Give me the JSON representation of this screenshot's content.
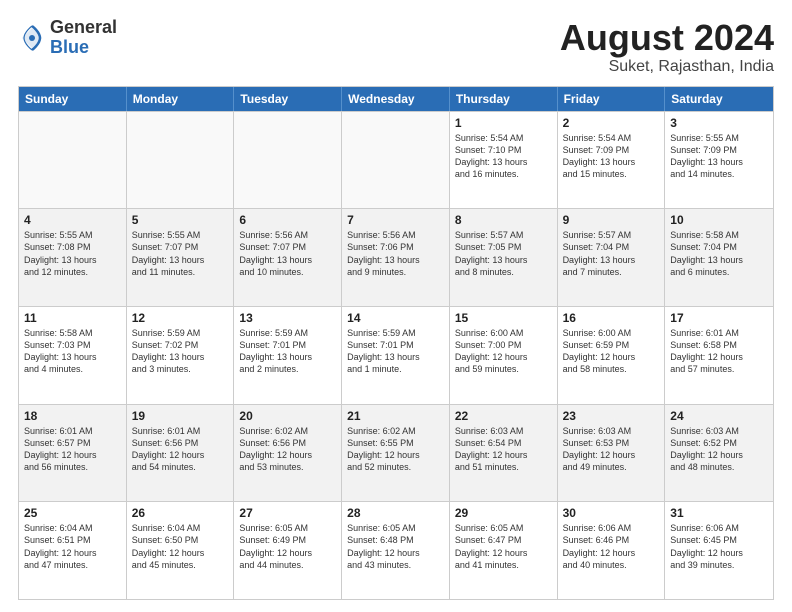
{
  "logo": {
    "general": "General",
    "blue": "Blue"
  },
  "title": "August 2024",
  "location": "Suket, Rajasthan, India",
  "days": [
    "Sunday",
    "Monday",
    "Tuesday",
    "Wednesday",
    "Thursday",
    "Friday",
    "Saturday"
  ],
  "rows": [
    [
      {
        "day": "",
        "text": "",
        "empty": true
      },
      {
        "day": "",
        "text": "",
        "empty": true
      },
      {
        "day": "",
        "text": "",
        "empty": true
      },
      {
        "day": "",
        "text": "",
        "empty": true
      },
      {
        "day": "1",
        "text": "Sunrise: 5:54 AM\nSunset: 7:10 PM\nDaylight: 13 hours\nand 16 minutes.",
        "empty": false
      },
      {
        "day": "2",
        "text": "Sunrise: 5:54 AM\nSunset: 7:09 PM\nDaylight: 13 hours\nand 15 minutes.",
        "empty": false
      },
      {
        "day": "3",
        "text": "Sunrise: 5:55 AM\nSunset: 7:09 PM\nDaylight: 13 hours\nand 14 minutes.",
        "empty": false
      }
    ],
    [
      {
        "day": "4",
        "text": "Sunrise: 5:55 AM\nSunset: 7:08 PM\nDaylight: 13 hours\nand 12 minutes.",
        "empty": false
      },
      {
        "day": "5",
        "text": "Sunrise: 5:55 AM\nSunset: 7:07 PM\nDaylight: 13 hours\nand 11 minutes.",
        "empty": false
      },
      {
        "day": "6",
        "text": "Sunrise: 5:56 AM\nSunset: 7:07 PM\nDaylight: 13 hours\nand 10 minutes.",
        "empty": false
      },
      {
        "day": "7",
        "text": "Sunrise: 5:56 AM\nSunset: 7:06 PM\nDaylight: 13 hours\nand 9 minutes.",
        "empty": false
      },
      {
        "day": "8",
        "text": "Sunrise: 5:57 AM\nSunset: 7:05 PM\nDaylight: 13 hours\nand 8 minutes.",
        "empty": false
      },
      {
        "day": "9",
        "text": "Sunrise: 5:57 AM\nSunset: 7:04 PM\nDaylight: 13 hours\nand 7 minutes.",
        "empty": false
      },
      {
        "day": "10",
        "text": "Sunrise: 5:58 AM\nSunset: 7:04 PM\nDaylight: 13 hours\nand 6 minutes.",
        "empty": false
      }
    ],
    [
      {
        "day": "11",
        "text": "Sunrise: 5:58 AM\nSunset: 7:03 PM\nDaylight: 13 hours\nand 4 minutes.",
        "empty": false
      },
      {
        "day": "12",
        "text": "Sunrise: 5:59 AM\nSunset: 7:02 PM\nDaylight: 13 hours\nand 3 minutes.",
        "empty": false
      },
      {
        "day": "13",
        "text": "Sunrise: 5:59 AM\nSunset: 7:01 PM\nDaylight: 13 hours\nand 2 minutes.",
        "empty": false
      },
      {
        "day": "14",
        "text": "Sunrise: 5:59 AM\nSunset: 7:01 PM\nDaylight: 13 hours\nand 1 minute.",
        "empty": false
      },
      {
        "day": "15",
        "text": "Sunrise: 6:00 AM\nSunset: 7:00 PM\nDaylight: 12 hours\nand 59 minutes.",
        "empty": false
      },
      {
        "day": "16",
        "text": "Sunrise: 6:00 AM\nSunset: 6:59 PM\nDaylight: 12 hours\nand 58 minutes.",
        "empty": false
      },
      {
        "day": "17",
        "text": "Sunrise: 6:01 AM\nSunset: 6:58 PM\nDaylight: 12 hours\nand 57 minutes.",
        "empty": false
      }
    ],
    [
      {
        "day": "18",
        "text": "Sunrise: 6:01 AM\nSunset: 6:57 PM\nDaylight: 12 hours\nand 56 minutes.",
        "empty": false
      },
      {
        "day": "19",
        "text": "Sunrise: 6:01 AM\nSunset: 6:56 PM\nDaylight: 12 hours\nand 54 minutes.",
        "empty": false
      },
      {
        "day": "20",
        "text": "Sunrise: 6:02 AM\nSunset: 6:56 PM\nDaylight: 12 hours\nand 53 minutes.",
        "empty": false
      },
      {
        "day": "21",
        "text": "Sunrise: 6:02 AM\nSunset: 6:55 PM\nDaylight: 12 hours\nand 52 minutes.",
        "empty": false
      },
      {
        "day": "22",
        "text": "Sunrise: 6:03 AM\nSunset: 6:54 PM\nDaylight: 12 hours\nand 51 minutes.",
        "empty": false
      },
      {
        "day": "23",
        "text": "Sunrise: 6:03 AM\nSunset: 6:53 PM\nDaylight: 12 hours\nand 49 minutes.",
        "empty": false
      },
      {
        "day": "24",
        "text": "Sunrise: 6:03 AM\nSunset: 6:52 PM\nDaylight: 12 hours\nand 48 minutes.",
        "empty": false
      }
    ],
    [
      {
        "day": "25",
        "text": "Sunrise: 6:04 AM\nSunset: 6:51 PM\nDaylight: 12 hours\nand 47 minutes.",
        "empty": false
      },
      {
        "day": "26",
        "text": "Sunrise: 6:04 AM\nSunset: 6:50 PM\nDaylight: 12 hours\nand 45 minutes.",
        "empty": false
      },
      {
        "day": "27",
        "text": "Sunrise: 6:05 AM\nSunset: 6:49 PM\nDaylight: 12 hours\nand 44 minutes.",
        "empty": false
      },
      {
        "day": "28",
        "text": "Sunrise: 6:05 AM\nSunset: 6:48 PM\nDaylight: 12 hours\nand 43 minutes.",
        "empty": false
      },
      {
        "day": "29",
        "text": "Sunrise: 6:05 AM\nSunset: 6:47 PM\nDaylight: 12 hours\nand 41 minutes.",
        "empty": false
      },
      {
        "day": "30",
        "text": "Sunrise: 6:06 AM\nSunset: 6:46 PM\nDaylight: 12 hours\nand 40 minutes.",
        "empty": false
      },
      {
        "day": "31",
        "text": "Sunrise: 6:06 AM\nSunset: 6:45 PM\nDaylight: 12 hours\nand 39 minutes.",
        "empty": false
      }
    ]
  ]
}
